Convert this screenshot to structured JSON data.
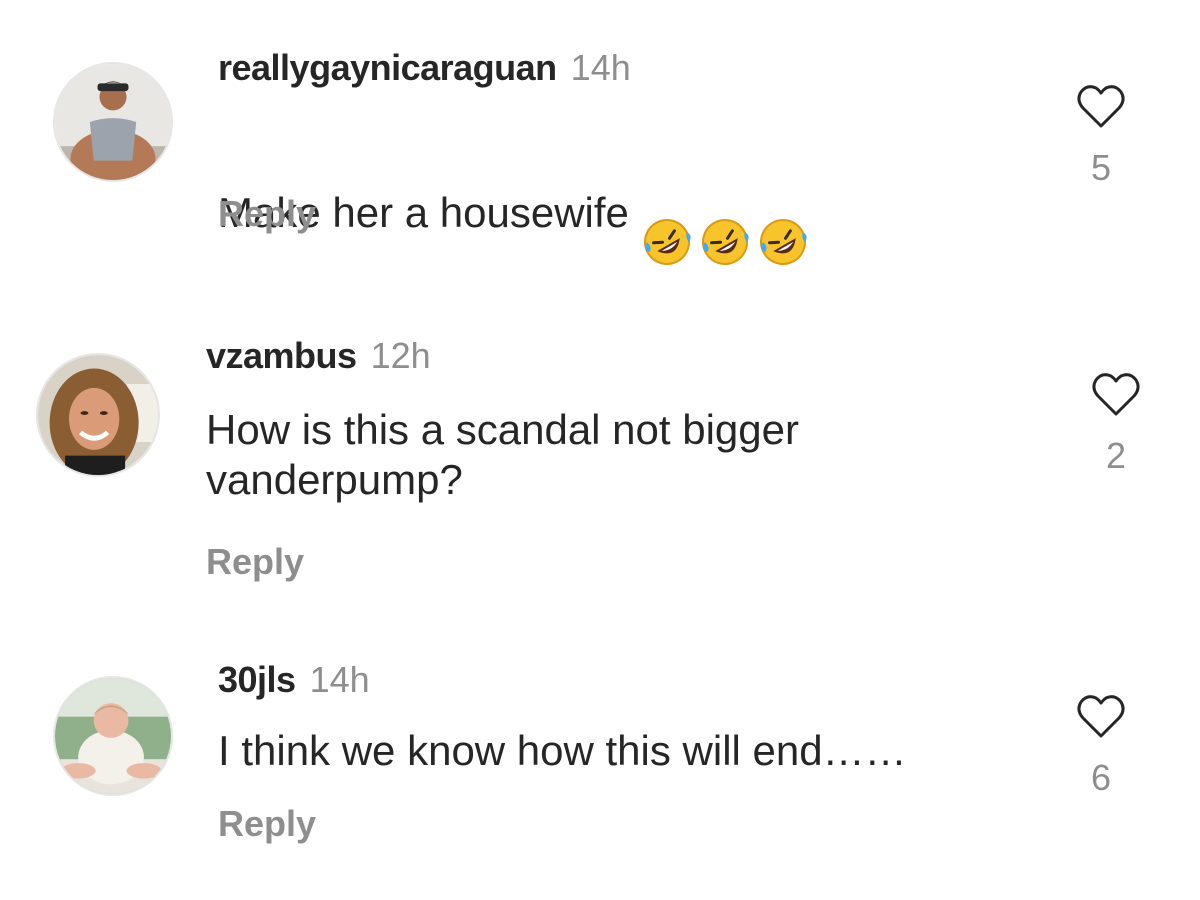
{
  "comments": [
    {
      "username": "reallygaynicaraguan",
      "time": "14h",
      "text": "Make her a housewife",
      "emojis": [
        "rolling-on-floor-laughing-emoji",
        "rolling-on-floor-laughing-emoji",
        "rolling-on-floor-laughing-emoji"
      ],
      "reply_label": "Reply",
      "likes": "5"
    },
    {
      "username": "vzambus",
      "time": "12h",
      "text": "How is this a scandal not bigger\nvanderpump?",
      "reply_label": "Reply",
      "likes": "2"
    },
    {
      "username": "30jls",
      "time": "14h",
      "text": "I think we know how this will end……",
      "reply_label": "Reply",
      "likes": "6"
    }
  ],
  "icons": {
    "like": "heart-outline-icon",
    "emoji": "rolling-on-floor-laughing-emoji"
  },
  "colors": {
    "text": "#262626",
    "muted": "#8e8e8e",
    "emoji_face": "#f7c52b",
    "emoji_tears": "#3fa9f5"
  }
}
